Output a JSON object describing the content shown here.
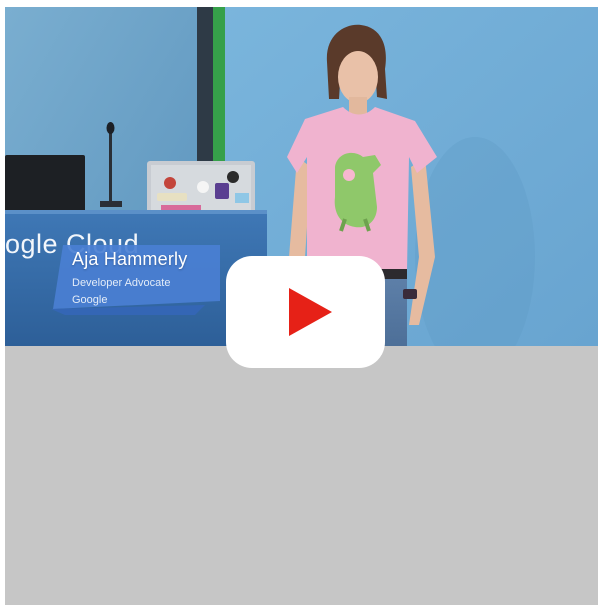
{
  "video": {
    "speaker_name": "Aja Hammerly",
    "speaker_title": "Developer Advocate",
    "speaker_org": "Google",
    "podium_brand": "ogle Cloud",
    "play_icon": "youtube-play-icon"
  },
  "colors": {
    "page_background": "#ffffff",
    "placeholder_gray": "#c6c6c6",
    "play_button_red": "#e62117",
    "play_button_white": "#ffffff",
    "lower_third_blue": "#4a7fd2"
  }
}
